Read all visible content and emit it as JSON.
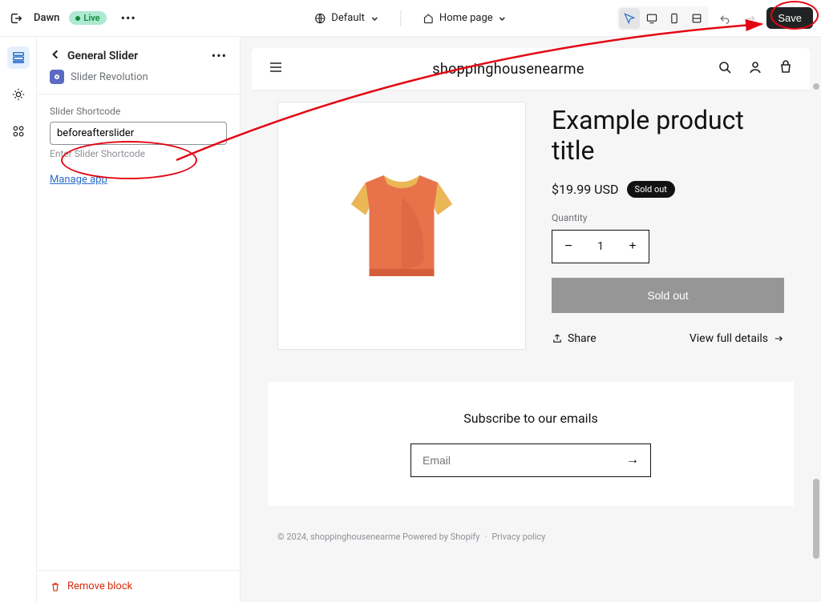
{
  "topbar": {
    "theme_name": "Dawn",
    "live_label": "Live",
    "locale_label": "Default",
    "page_label": "Home page",
    "save_label": "Save"
  },
  "sidebar": {
    "title": "General Slider",
    "app_name": "Slider Revolution",
    "field_label": "Slider Shortcode",
    "field_value": "beforeafterslider",
    "field_hint": "Enter Slider Shortcode",
    "manage_label": "Manage app",
    "remove_label": "Remove block"
  },
  "store": {
    "name": "shoppinghousenearme",
    "product_title": "Example product title",
    "price": "$19.99 USD",
    "soldout_badge": "Sold out",
    "quantity_label": "Quantity",
    "quantity_value": "1",
    "add_label": "Sold out",
    "share_label": "Share",
    "details_label": "View full details",
    "subscribe_title": "Subscribe to our emails",
    "email_placeholder": "Email",
    "footer_copyright": "© 2024, ",
    "footer_store": "shoppinghousenearme",
    "footer_powered": " Powered by Shopify",
    "footer_privacy": "Privacy policy"
  }
}
